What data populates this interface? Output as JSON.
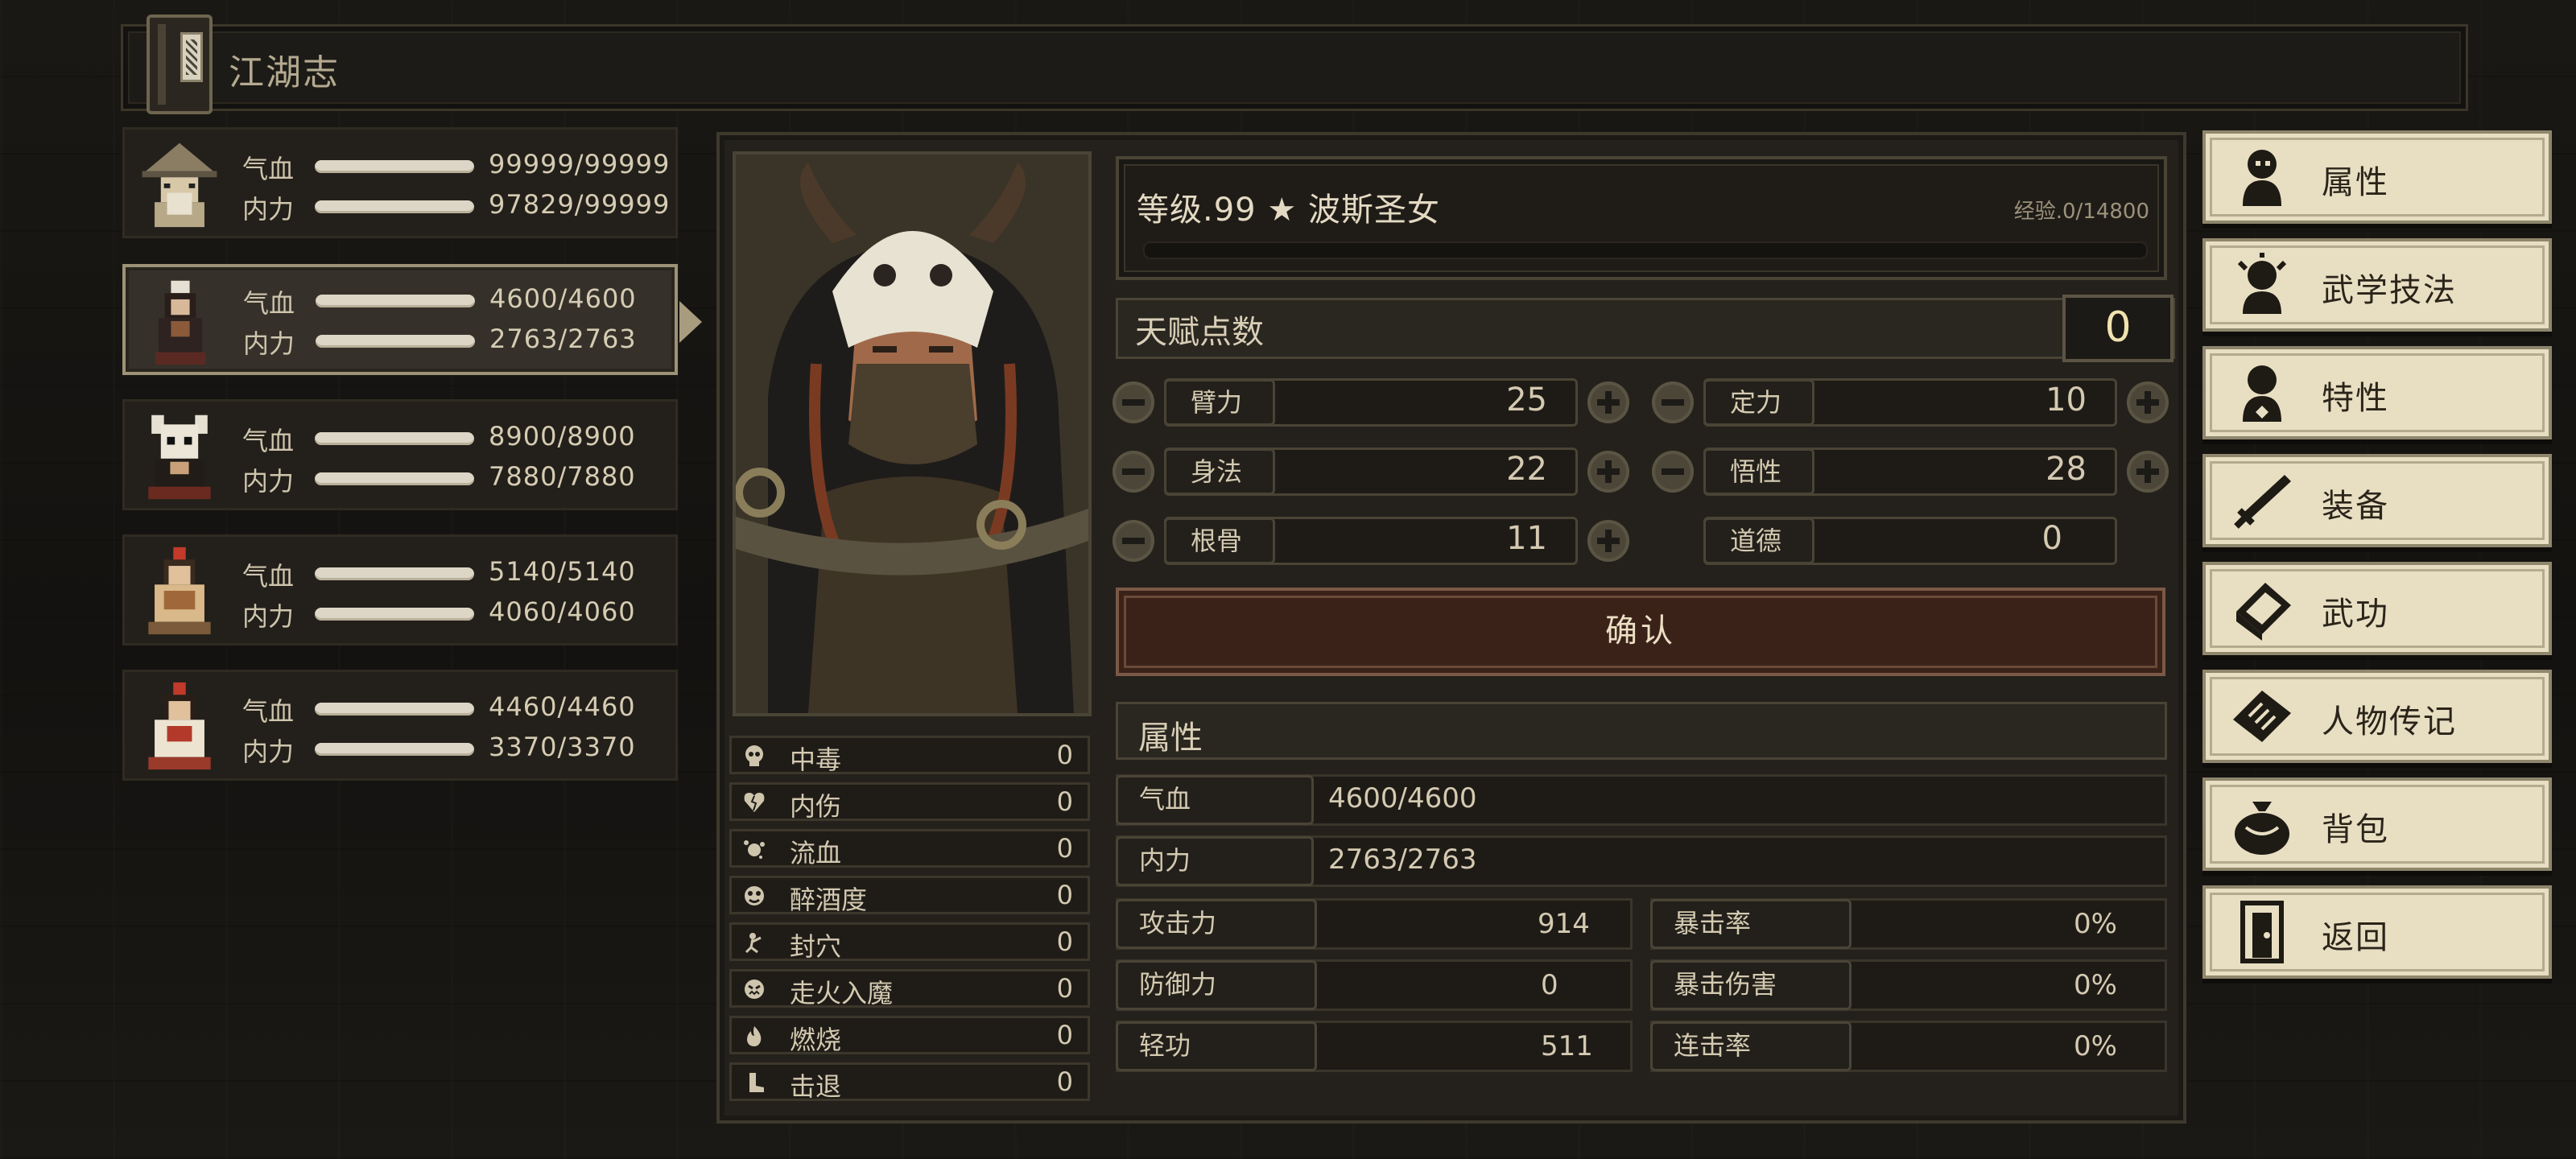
{
  "title": "江湖志",
  "party": [
    {
      "hp_label": "气血",
      "hp": "99999/99999",
      "mp_label": "内力",
      "mp": "97829/99999",
      "selected": false
    },
    {
      "hp_label": "气血",
      "hp": "4600/4600",
      "mp_label": "内力",
      "mp": "2763/2763",
      "selected": true
    },
    {
      "hp_label": "气血",
      "hp": "8900/8900",
      "mp_label": "内力",
      "mp": "7880/7880",
      "selected": false
    },
    {
      "hp_label": "气血",
      "hp": "5140/5140",
      "mp_label": "内力",
      "mp": "4060/4060",
      "selected": false
    },
    {
      "hp_label": "气血",
      "hp": "4460/4460",
      "mp_label": "内力",
      "mp": "3370/3370",
      "selected": false
    }
  ],
  "character": {
    "level_line": "等级.99  ★ 波斯圣女",
    "exp": "经验.0/14800",
    "exp_fraction": 0
  },
  "talent": {
    "label": "天赋点数",
    "points": "0"
  },
  "attributes": [
    {
      "name": "臂力",
      "value": "25"
    },
    {
      "name": "定力",
      "value": "10"
    },
    {
      "name": "身法",
      "value": "22"
    },
    {
      "name": "悟性",
      "value": "28"
    },
    {
      "name": "根骨",
      "value": "11"
    },
    {
      "name": "道德",
      "value": "0"
    }
  ],
  "confirm_label": "确认",
  "props": {
    "header": "属性",
    "hp_label": "气血",
    "hp": "4600/4600",
    "mp_label": "内力",
    "mp": "2763/2763",
    "rows": [
      {
        "left_label": "攻击力",
        "left_value": "914",
        "right_label": "暴击率",
        "right_value": "0%"
      },
      {
        "left_label": "防御力",
        "left_value": "0",
        "right_label": "暴击伤害",
        "right_value": "0%"
      },
      {
        "left_label": "轻功",
        "left_value": "511",
        "right_label": "连击率",
        "right_value": "0%"
      }
    ]
  },
  "statuses": [
    {
      "name": "中毒",
      "value": "0",
      "icon": "skull-icon"
    },
    {
      "name": "内伤",
      "value": "0",
      "icon": "broken-heart-icon"
    },
    {
      "name": "流血",
      "value": "0",
      "icon": "blood-icon"
    },
    {
      "name": "醉酒度",
      "value": "0",
      "icon": "drunk-icon"
    },
    {
      "name": "封穴",
      "value": "0",
      "icon": "acupoint-icon"
    },
    {
      "name": "走火入魔",
      "value": "0",
      "icon": "demon-icon"
    },
    {
      "name": "燃烧",
      "value": "0",
      "icon": "fire-icon"
    },
    {
      "name": "击退",
      "value": "0",
      "icon": "boot-icon"
    }
  ],
  "menu": [
    {
      "label": "属性",
      "icon": "person-icon"
    },
    {
      "label": "武学技法",
      "icon": "martial-person-icon"
    },
    {
      "label": "特性",
      "icon": "trait-person-icon"
    },
    {
      "label": "装备",
      "icon": "sword-icon"
    },
    {
      "label": "武功",
      "icon": "book-icon"
    },
    {
      "label": "人物传记",
      "icon": "scroll-icon"
    },
    {
      "label": "背包",
      "icon": "bag-icon"
    },
    {
      "label": "返回",
      "icon": "door-icon"
    }
  ]
}
